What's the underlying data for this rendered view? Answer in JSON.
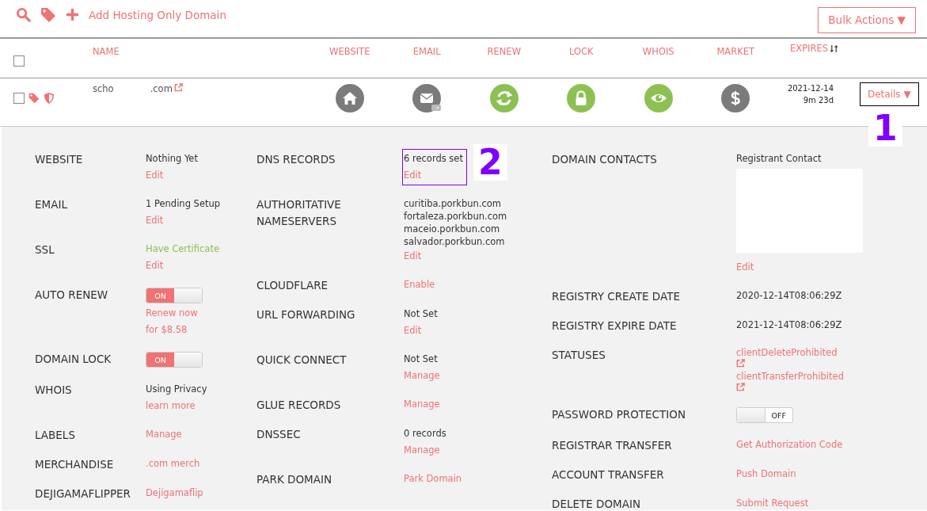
{
  "toolbar": {
    "add_link": "Add Hosting Only Domain",
    "bulk_button": "Bulk Actions ▼"
  },
  "table": {
    "select_all_checked": false,
    "columns": [
      "NAME",
      "WEBSITE",
      "EMAIL",
      "RENEW",
      "LOCK",
      "WHOIS",
      "MARKET",
      "EXPIRES"
    ],
    "rows": [
      {
        "checked": false,
        "name_start": "scho",
        "name_end": ".com",
        "status_icons": [
          {
            "kind": "home",
            "on": false
          },
          {
            "kind": "email",
            "on": false
          },
          {
            "kind": "renew",
            "on": true
          },
          {
            "kind": "lock",
            "on": true
          },
          {
            "kind": "whois",
            "on": true
          },
          {
            "kind": "market",
            "on": false
          }
        ],
        "expires_date": "2021-12-14",
        "expires_left": "9m 23d",
        "details_button": "Details ▼",
        "annotation": "1"
      }
    ]
  },
  "details": {
    "columns": [
      {
        "rows": [
          {
            "label": "WEBSITE",
            "items": [
              {
                "kind": "text",
                "text": "Nothing Yet"
              },
              {
                "kind": "link",
                "text": "Edit"
              }
            ]
          },
          {
            "label": "EMAIL",
            "items": [
              {
                "kind": "text",
                "text": "1 Pending Setup"
              },
              {
                "kind": "link",
                "text": "Edit"
              }
            ]
          },
          {
            "label": "SSL",
            "items": [
              {
                "kind": "success",
                "text": "Have Certificate"
              },
              {
                "kind": "link",
                "text": "Edit"
              }
            ]
          },
          {
            "label": "AUTO RENEW",
            "items": [
              {
                "kind": "toggle",
                "on": true,
                "text": "ON"
              },
              {
                "kind": "link",
                "text": "Renew now"
              },
              {
                "kind": "link",
                "text": "for $8.58"
              }
            ]
          },
          {
            "label": "DOMAIN LOCK",
            "items": [
              {
                "kind": "toggle",
                "on": true,
                "text": "ON"
              }
            ]
          },
          {
            "label": "WHOIS",
            "items": [
              {
                "kind": "text",
                "text": "Using Privacy"
              },
              {
                "kind": "link",
                "text": "learn more"
              }
            ]
          },
          {
            "label": "LABELS",
            "items": [
              {
                "kind": "link",
                "text": "Manage"
              }
            ]
          },
          {
            "label": "MERCHANDISE",
            "items": [
              {
                "kind": "link",
                "text": ".com merch"
              }
            ]
          },
          {
            "label": "DEJIGAMAFLIPPER",
            "items": [
              {
                "kind": "link",
                "text": "Dejigamaflip"
              }
            ]
          }
        ]
      },
      {
        "rows": [
          {
            "label": "DNS RECORDS",
            "annotation": "2",
            "items": [
              {
                "kind": "text",
                "text": "6 records set"
              },
              {
                "kind": "link",
                "text": "Edit"
              }
            ]
          },
          {
            "label": "AUTHORITATIVE NAMESERVERS",
            "items": [
              {
                "kind": "lines",
                "lines": [
                  "curitiba.porkbun.com",
                  "fortaleza.porkbun.com",
                  "maceio.porkbun.com",
                  "salvador.porkbun.com"
                ]
              },
              {
                "kind": "link",
                "text": "Edit"
              }
            ]
          },
          {
            "label": "CLOUDFLARE",
            "items": [
              {
                "kind": "link",
                "text": "Enable"
              }
            ]
          },
          {
            "label": "URL FORWARDING",
            "items": [
              {
                "kind": "text",
                "text": "Not Set"
              },
              {
                "kind": "link",
                "text": "Edit"
              }
            ]
          },
          {
            "label": "QUICK CONNECT",
            "items": [
              {
                "kind": "text",
                "text": "Not Set"
              },
              {
                "kind": "link",
                "text": "Manage"
              }
            ]
          },
          {
            "label": "GLUE RECORDS",
            "items": [
              {
                "kind": "link",
                "text": "Manage"
              }
            ]
          },
          {
            "label": "DNSSEC",
            "items": [
              {
                "kind": "text",
                "text": "0 records"
              },
              {
                "kind": "link",
                "text": "Manage"
              }
            ]
          },
          {
            "label": "PARK DOMAIN",
            "items": [
              {
                "kind": "link",
                "text": "Park Domain"
              }
            ]
          }
        ]
      },
      {
        "rows": [
          {
            "label": "DOMAIN CONTACTS",
            "items": [
              {
                "kind": "text",
                "text": "Registrant Contact"
              },
              {
                "kind": "blank"
              },
              {
                "kind": "link",
                "text": "Edit"
              }
            ]
          },
          {
            "label": "REGISTRY CREATE DATE",
            "items": [
              {
                "kind": "text",
                "text": "2020-12-14T08:06:29Z"
              }
            ]
          },
          {
            "label": "REGISTRY EXPIRE DATE",
            "items": [
              {
                "kind": "text",
                "text": "2021-12-14T08:06:29Z"
              }
            ]
          },
          {
            "label": "STATUSES",
            "items": [
              {
                "kind": "external",
                "text": "clientDeleteProhibited"
              },
              {
                "kind": "external",
                "text": "clientTransferProhibited"
              }
            ]
          },
          {
            "label": "PASSWORD PROTECTION",
            "items": [
              {
                "kind": "toggle",
                "on": false,
                "text": "OFF"
              }
            ]
          },
          {
            "label": "REGISTRAR TRANSFER",
            "items": [
              {
                "kind": "link",
                "text": "Get Authorization Code"
              }
            ]
          },
          {
            "label": "ACCOUNT TRANSFER",
            "items": [
              {
                "kind": "link",
                "text": "Push Domain"
              }
            ]
          },
          {
            "label": "DELETE DOMAIN",
            "items": [
              {
                "kind": "link",
                "text": "Submit Request"
              }
            ]
          }
        ]
      }
    ]
  }
}
